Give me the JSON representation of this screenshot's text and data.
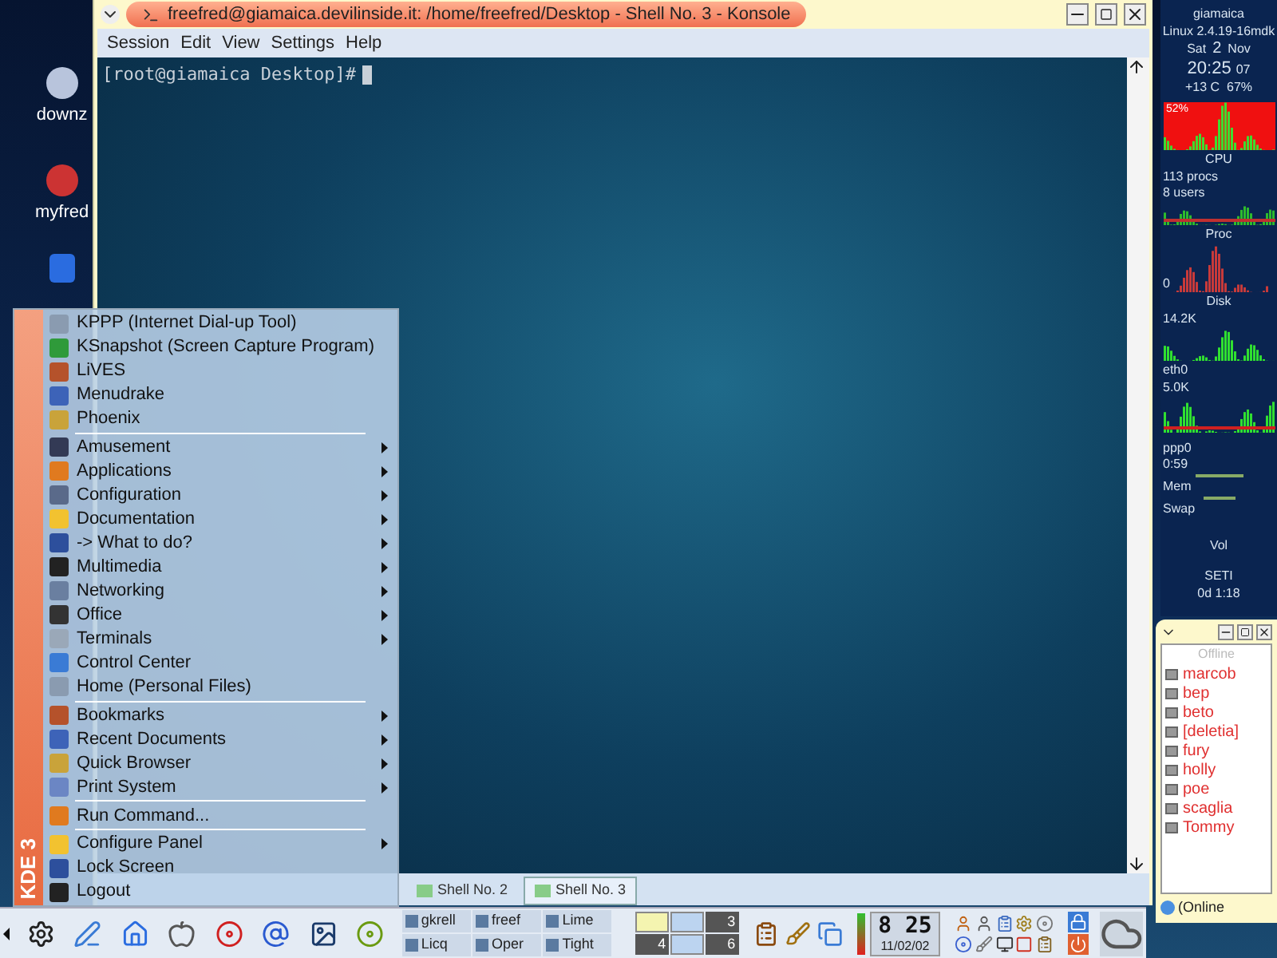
{
  "desktop_icons": [
    {
      "label": "downz"
    },
    {
      "label": "myfred"
    }
  ],
  "konsole": {
    "title": "freefred@giamaica.devilinside.it: /home/freefred/Desktop - Shell No. 3 - Konsole",
    "menu": [
      "Session",
      "Edit",
      "View",
      "Settings",
      "Help"
    ],
    "prompt": "[root@giamaica Desktop]#",
    "sessions": [
      {
        "label": "Shell No. 2",
        "selected": false
      },
      {
        "label": "Shell No. 3",
        "selected": true
      }
    ]
  },
  "gkrellm": {
    "hostname": "giamaica",
    "kernel": "Linux 2.4.19-16mdk",
    "day": "Sat",
    "date": "2",
    "month": "Nov",
    "time": "20:25",
    "seconds": "07",
    "sensors": "+13 C  67%",
    "cpu_percent": "52%",
    "cpu_label": "CPU",
    "procs": "113 procs",
    "users": "8 users",
    "proc_label": "Proc",
    "proc_value": "0",
    "disk_label": "Disk",
    "disk_value": "14.2K",
    "eth_label": "eth0",
    "eth_value": "5.0K",
    "ppp_label": "ppp0",
    "ppp_time": "0:59",
    "mem_label": "Mem",
    "swap_label": "Swap",
    "vol_label": "Vol",
    "seti_label": "SETI",
    "seti_time": "0d 1:18"
  },
  "kmenu": {
    "side_label": "KDE 3",
    "items": [
      {
        "kind": "item",
        "label": "KPPP (Internet Dial-up Tool)"
      },
      {
        "kind": "item",
        "label": "KSnapshot (Screen Capture Program)"
      },
      {
        "kind": "item",
        "label": "LiVES"
      },
      {
        "kind": "item",
        "label": "Menudrake"
      },
      {
        "kind": "item",
        "label": "Phoenix"
      },
      {
        "kind": "separator"
      },
      {
        "kind": "submenu",
        "label": "Amusement"
      },
      {
        "kind": "submenu",
        "label": "Applications"
      },
      {
        "kind": "submenu",
        "label": "Configuration"
      },
      {
        "kind": "submenu",
        "label": "Documentation"
      },
      {
        "kind": "submenu",
        "label": "-> What to do?"
      },
      {
        "kind": "submenu",
        "label": "Multimedia"
      },
      {
        "kind": "submenu",
        "label": "Networking"
      },
      {
        "kind": "submenu",
        "label": "Office"
      },
      {
        "kind": "submenu",
        "label": "Terminals"
      },
      {
        "kind": "item",
        "label": "Control Center"
      },
      {
        "kind": "item",
        "label": "Home (Personal Files)"
      },
      {
        "kind": "separator"
      },
      {
        "kind": "submenu",
        "label": "Bookmarks"
      },
      {
        "kind": "submenu",
        "label": "Recent Documents"
      },
      {
        "kind": "submenu",
        "label": "Quick Browser"
      },
      {
        "kind": "submenu",
        "label": "Print System"
      },
      {
        "kind": "separator"
      },
      {
        "kind": "item",
        "label": "Run Command..."
      },
      {
        "kind": "separator"
      },
      {
        "kind": "submenu",
        "label": "Configure Panel"
      },
      {
        "kind": "item",
        "label": "Lock Screen"
      },
      {
        "kind": "item",
        "label": "Logout"
      }
    ]
  },
  "licq": {
    "group": "Offline",
    "contacts": [
      "marcob",
      "bep",
      "beto",
      "[deletia]",
      "fury",
      "holly",
      "poe",
      "scaglia",
      "Tommy"
    ],
    "status": "(Online"
  },
  "panel": {
    "tasks": [
      "gkrell",
      "freef",
      "Lime",
      "Licq",
      "Oper",
      "Tight"
    ],
    "pager": [
      {
        "kind": "thumb",
        "selected": true
      },
      {
        "kind": "thumb",
        "selected": false
      },
      {
        "kind": "number",
        "label": "3",
        "selected": false
      },
      {
        "kind": "number",
        "label": "4",
        "selected": false
      },
      {
        "kind": "thumb",
        "selected": false
      },
      {
        "kind": "number",
        "label": "6",
        "selected": false
      }
    ],
    "clock": {
      "time": "8 25",
      "date": "11/02/02"
    }
  }
}
